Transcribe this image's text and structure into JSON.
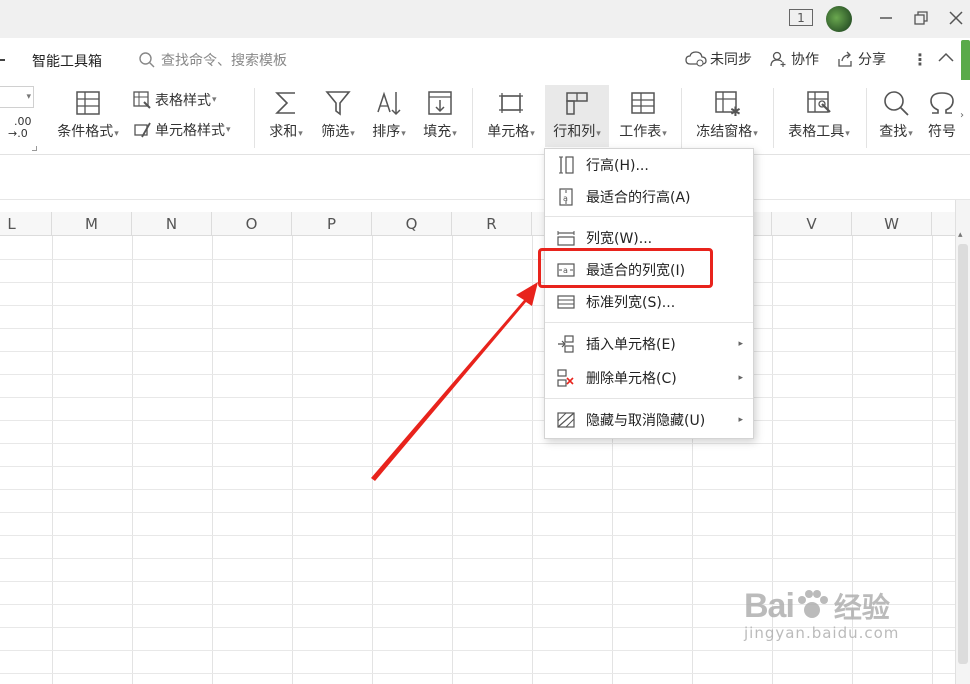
{
  "titlebar": {
    "page_indicator": "1"
  },
  "menubar": {
    "smart_toolbox": "智能工具箱",
    "search_placeholder": "查找命令、搜索模板",
    "sync_label": "未同步",
    "collab_label": "协作",
    "share_label": "分享"
  },
  "ribbon": {
    "decimal_top": ".00",
    "decimal_bottom": "→.0",
    "conditional_format": "条件格式",
    "table_style": "表格样式",
    "cell_style": "单元格样式",
    "sum": "求和",
    "filter": "筛选",
    "sort": "排序",
    "fill": "填充",
    "cell": "单元格",
    "row_col": "行和列",
    "worksheet": "工作表",
    "freeze": "冻结窗格",
    "table_tools": "表格工具",
    "find": "查找",
    "symbol": "符号"
  },
  "columns": [
    "L",
    "M",
    "N",
    "O",
    "P",
    "Q",
    "R",
    "S",
    "T",
    "U",
    "V",
    "W"
  ],
  "menu": {
    "items": [
      {
        "label": "行高(H)...",
        "icon": "row-height-icon"
      },
      {
        "label": "最适合的行高(A)",
        "icon": "best-fit-row-icon"
      },
      {
        "label": "列宽(W)...",
        "icon": "column-width-icon"
      },
      {
        "label": "最适合的列宽(I)",
        "icon": "best-fit-column-icon"
      },
      {
        "label": "标准列宽(S)...",
        "icon": "standard-width-icon"
      },
      {
        "label": "插入单元格(E)",
        "icon": "insert-cell-icon"
      },
      {
        "label": "删除单元格(C)",
        "icon": "delete-cell-icon"
      },
      {
        "label": "隐藏与取消隐藏(U)",
        "icon": "hide-unhide-icon"
      }
    ]
  },
  "watermark": {
    "brand": "Bai",
    "brand_cn": "经验",
    "url": "jingyan.baidu.com"
  },
  "colors": {
    "highlight": "#e8231c",
    "arrow": "#e8231c",
    "active_tab_bg": "#e9e9e9"
  }
}
